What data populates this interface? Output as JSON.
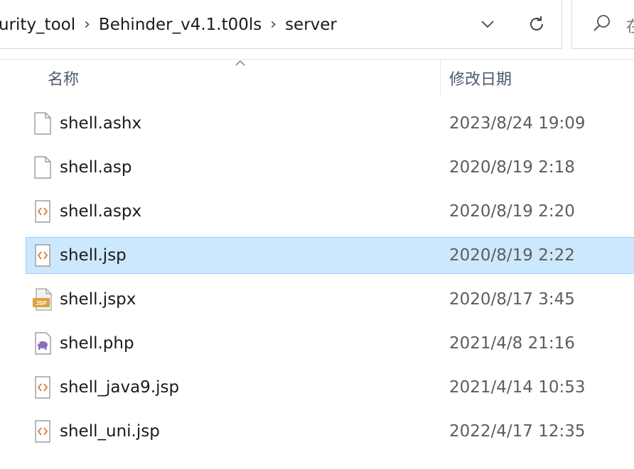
{
  "breadcrumb": {
    "items": [
      "urity_tool",
      "Behinder_v4.1.t00ls",
      "server"
    ]
  },
  "search": {
    "placeholder": "在"
  },
  "columns": {
    "name": "名称",
    "date_modified": "修改日期"
  },
  "files": [
    {
      "name": "shell.ashx",
      "date": "2023/8/24 19:09",
      "icon": "blank-file-icon"
    },
    {
      "name": "shell.asp",
      "date": "2020/8/19 2:18",
      "icon": "blank-file-icon"
    },
    {
      "name": "shell.aspx",
      "date": "2020/8/19 2:20",
      "icon": "code-file-icon"
    },
    {
      "name": "shell.jsp",
      "date": "2020/8/19 2:22",
      "icon": "code-file-icon",
      "selected": true
    },
    {
      "name": "shell.jspx",
      "date": "2020/8/17 3:45",
      "icon": "jsp-file-icon"
    },
    {
      "name": "shell.php",
      "date": "2021/4/8 21:16",
      "icon": "php-file-icon"
    },
    {
      "name": "shell_java9.jsp",
      "date": "2021/4/14 10:53",
      "icon": "code-file-icon"
    },
    {
      "name": "shell_uni.jsp",
      "date": "2022/4/17 12:35",
      "icon": "code-file-icon"
    }
  ],
  "icon_labels": {
    "jsp_badge": "JSP"
  },
  "colors": {
    "selection_bg": "#cce8ff",
    "selection_border": "#99d1ff",
    "code_icon_accent": "#d86b2a",
    "php_icon_accent": "#8a6fb8",
    "jsp_badge": "#d8a53a"
  }
}
